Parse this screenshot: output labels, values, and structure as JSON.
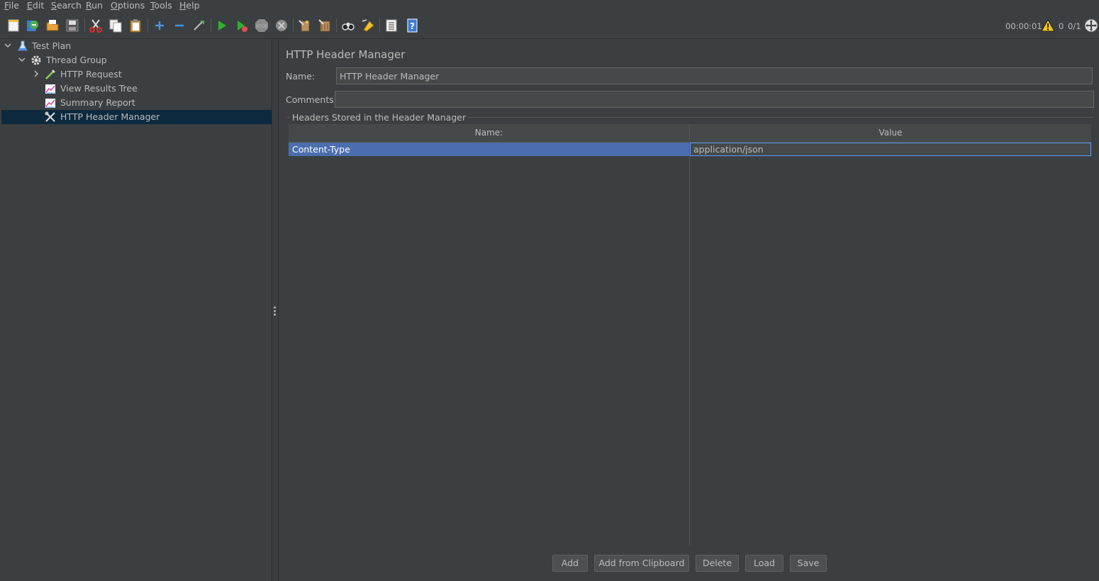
{
  "menu": {
    "items": [
      "File",
      "Edit",
      "Search",
      "Run",
      "Options",
      "Tools",
      "Help"
    ]
  },
  "toolbar": {
    "icons": [
      "new-icon",
      "templates-icon",
      "open-icon",
      "save-icon",
      "cut-icon",
      "copy-icon",
      "paste-icon",
      "expand-icon",
      "collapse-icon",
      "toggle-icon",
      "start-icon",
      "start-no-pause-icon",
      "stop-icon",
      "shutdown-icon",
      "clear-icon",
      "clear-all-icon",
      "search-icon",
      "reset-search-icon",
      "function-helper-icon",
      "help-icon"
    ],
    "timer": "00:00:01",
    "error_count": "0",
    "threads": "0/1"
  },
  "tree": {
    "items": [
      {
        "label": "Test Plan",
        "icon": "test-plan-icon"
      },
      {
        "label": "Thread Group",
        "icon": "gear-icon"
      },
      {
        "label": "HTTP Request",
        "icon": "pipette-icon"
      },
      {
        "label": "View Results Tree",
        "icon": "graph-icon"
      },
      {
        "label": "Summary Report",
        "icon": "graph-icon"
      },
      {
        "label": "HTTP Header Manager",
        "icon": "wrench-icon"
      }
    ],
    "selected": "HTTP Header Manager"
  },
  "panel": {
    "title": "HTTP Header Manager",
    "name_label": "Name:",
    "name_value": "HTTP Header Manager",
    "comments_label": "Comments:",
    "comments_value": "",
    "group_title": "Headers Stored in the Header Manager"
  },
  "table": {
    "columns": [
      "Name:",
      "Value"
    ],
    "rows": [
      {
        "name": "Content-Type",
        "value": "application/json"
      }
    ]
  },
  "buttons": {
    "add": "Add",
    "add_from_clipboard": "Add from Clipboard",
    "delete": "Delete",
    "load": "Load",
    "save": "Save"
  },
  "colors": {
    "background": "#3c3f41",
    "selection": "#4b6eaf",
    "tree_selection": "#0d293e",
    "text": "#bbbbbb"
  }
}
